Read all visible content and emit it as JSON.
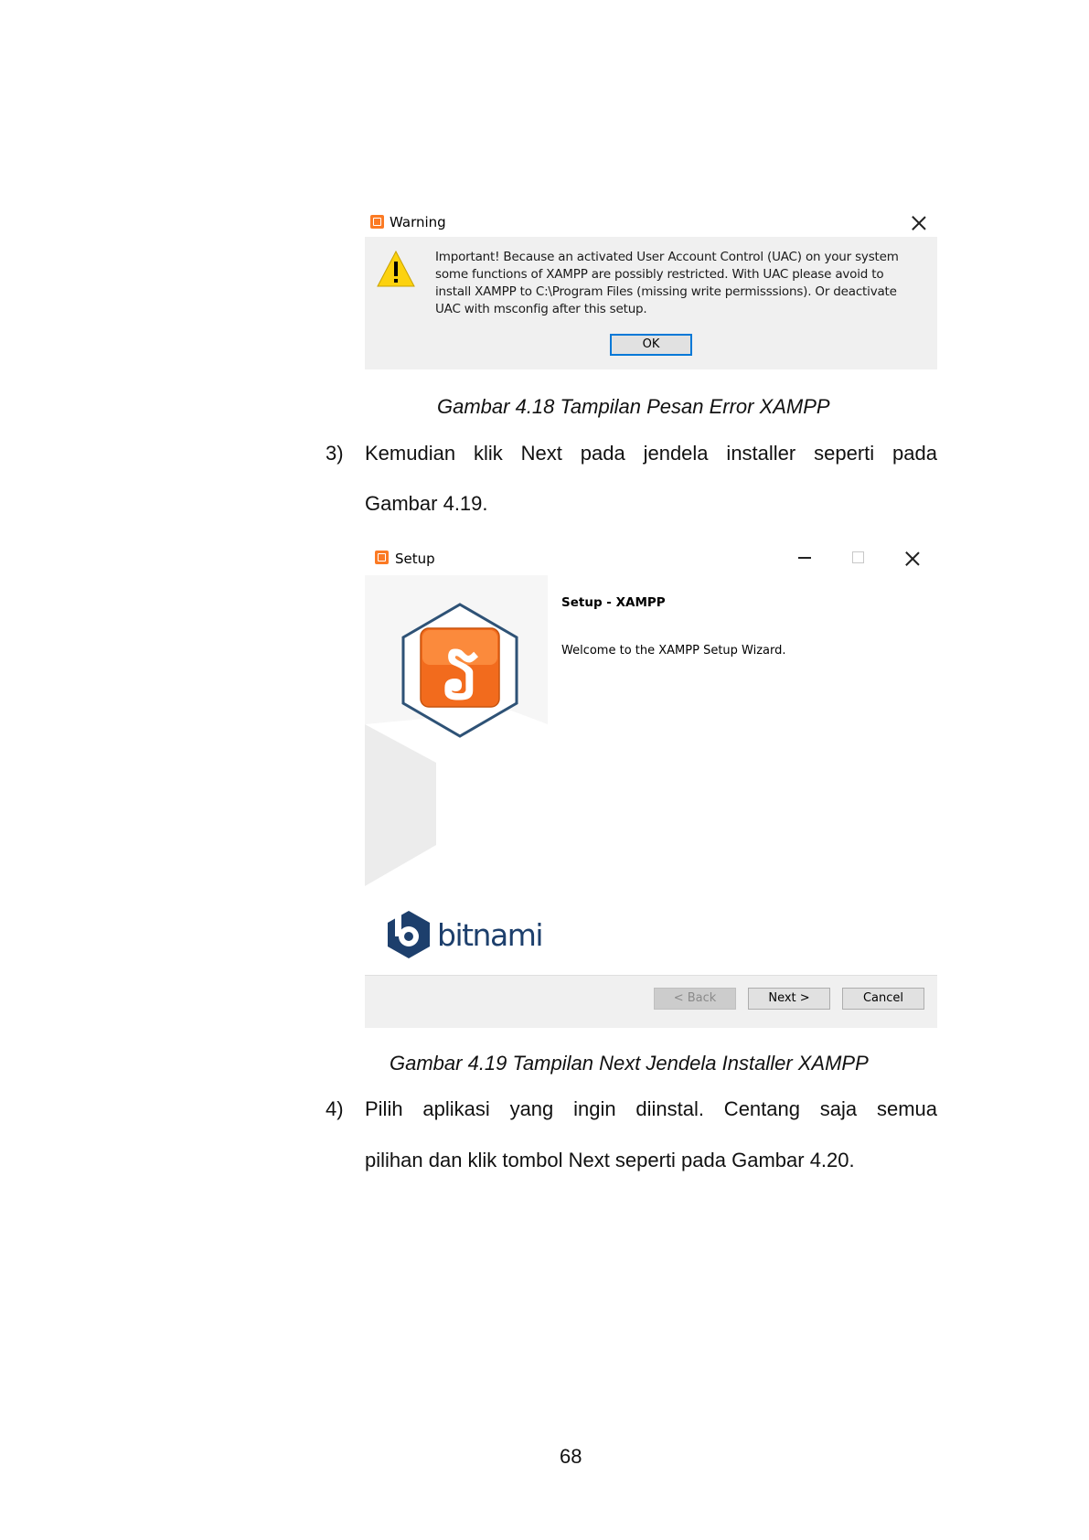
{
  "warning_dialog": {
    "title": "Warning",
    "message": "Important! Because an activated User Account Control (UAC) on your system some functions of XAMPP are possibly restricted. With UAC please avoid to install XAMPP to C:\\Program Files (missing write permisssions). Or deactivate UAC with msconfig after this setup.",
    "ok_label": "OK"
  },
  "caption_1": "Gambar 4.18 Tampilan Pesan Error XAMPP",
  "item_3": {
    "number": "3)",
    "line_1": "Kemudian klik Next pada jendela installer seperti pada",
    "line_2": "Gambar 4.19."
  },
  "setup_window": {
    "title": "Setup",
    "heading": "Setup - XAMPP",
    "welcome": "Welcome to the XAMPP Setup Wizard.",
    "brand": "bitnami",
    "back_label": "< Back",
    "next_label": "Next >",
    "cancel_label": "Cancel"
  },
  "caption_2": "Gambar 4.19 Tampilan Next Jendela Installer XAMPP",
  "item_4": {
    "number": "4)",
    "line_1": "Pilih aplikasi yang ingin diinstal. Centang saja semua",
    "line_2": "pilihan dan klik tombol Next seperti pada Gambar 4.20."
  },
  "page_number": "68",
  "colors": {
    "xampp_orange": "#fb7a24",
    "ok_border": "#0078d7",
    "bitnami_blue": "#1d3f6c"
  }
}
